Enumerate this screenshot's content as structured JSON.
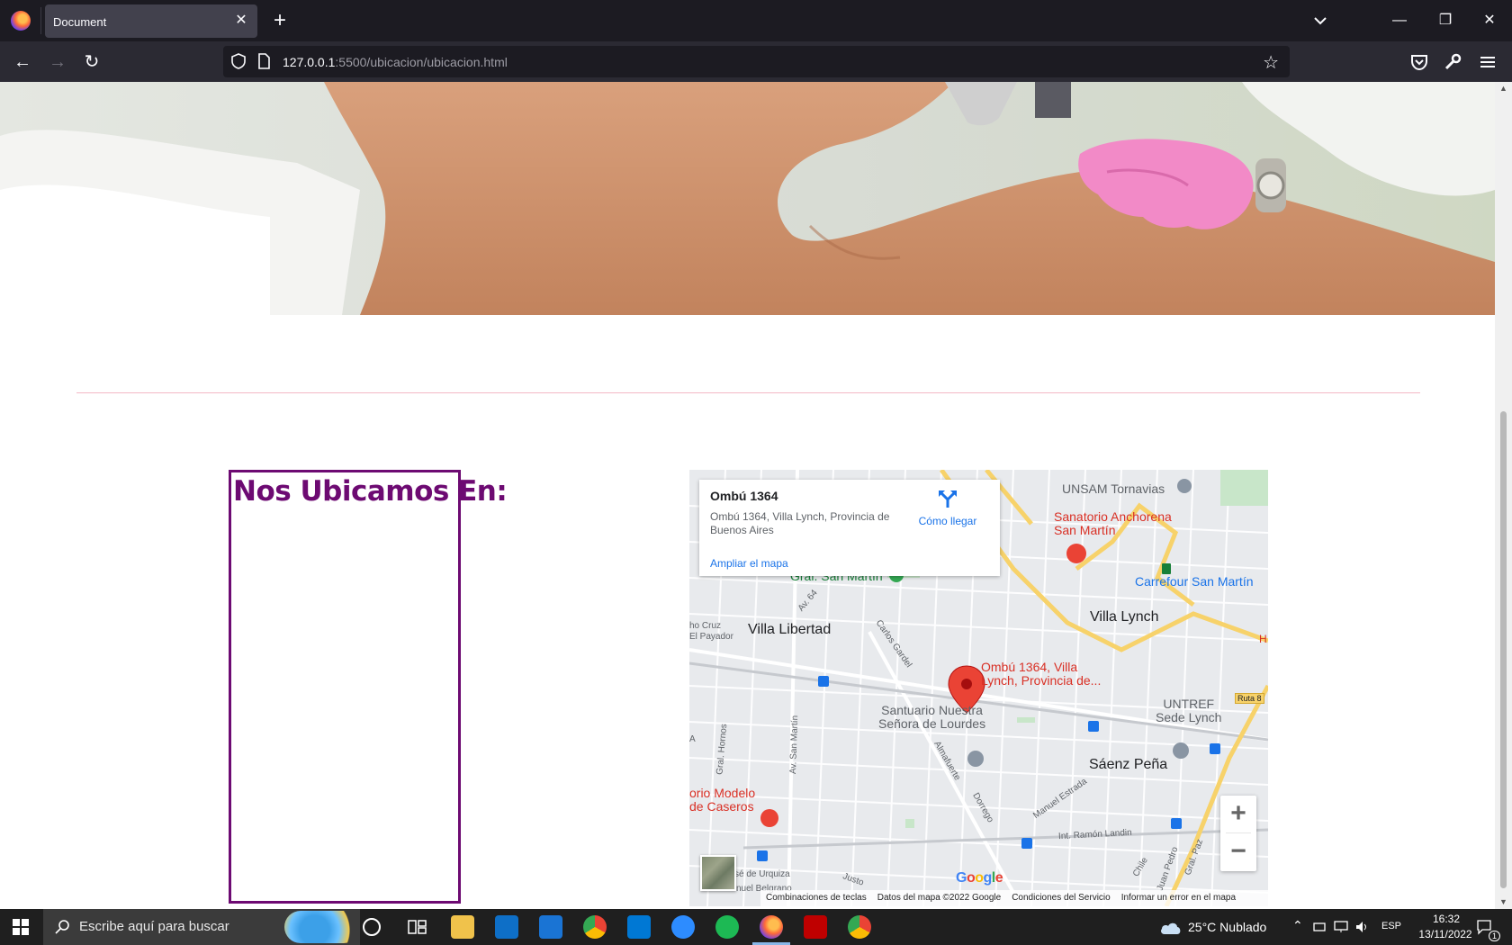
{
  "browser": {
    "tab_title": "Document",
    "url_host": "127.0.0.1",
    "url_path": ":5500/ubicacion/ubicacion.html"
  },
  "page": {
    "location_heading": "Nos Ubicamos En:"
  },
  "map": {
    "card_title": "Ombú 1364",
    "card_address": "Ombú 1364, Villa Lynch, Provincia de Buenos Aires",
    "directions_label": "Cómo llegar",
    "enlarge_link": "Ampliar el mapa",
    "pin_label_line1": "Ombú 1364, Villa",
    "pin_label_line2": "Lynch, Provincia de...",
    "labels": {
      "unsam": "UNSAM Tornavias",
      "sanatorio_line1": "Sanatorio Anchorena",
      "sanatorio_line2": "San Martín",
      "carrefour": "Carrefour San Martín",
      "gral_san_martin": "Gral. San Martín",
      "villa_libertad": "Villa Libertad",
      "villa_lynch": "Villa Lynch",
      "santuario_line1": "Santuario Nuestra",
      "santuario_line2": "Señora de Lourdes",
      "untref_line1": "UNTREF",
      "untref_line2": "Sede Lynch",
      "saenz_pena": "Sáenz Peña",
      "modelo_line1": "orio Modelo",
      "modelo_line2": "de Caseros",
      "ruta8": "Ruta 8",
      "av64": "Av. 64",
      "carlos_gardel": "Carlos Gardel",
      "cruz_line1": "ho Cruz",
      "cruz_line2": "El Payador",
      "av_san_martin": "Av. San Martín",
      "gral_hornos": "Gral. Hornos",
      "almafuerte": "Almafuerte",
      "dorrego": "Dorrego",
      "manuel_estrada": "Manuel Estrada",
      "ramon_landin": "Int. Ramón Landin",
      "chile": "Chile",
      "juan_pedro": "Juan Pedro",
      "gral_paz": "Gral. Paz",
      "urquiza": "sé de Urquiza",
      "belgrano": "nuel Belgrano",
      "justo": "Justo",
      "a_edge": "A",
      "h_edge": "H"
    },
    "zoom_in": "+",
    "zoom_out": "−",
    "google": "Google",
    "footer": {
      "shortcuts": "Combinaciones de teclas",
      "data": "Datos del mapa ©2022 Google",
      "terms": "Condiciones del Servicio",
      "report": "Informar un error en el mapa"
    }
  },
  "taskbar": {
    "search_placeholder": "Escribe aquí para buscar",
    "weather": "25°C  Nublado",
    "language": "ESP",
    "time": "16:32",
    "date": "13/11/2022",
    "notifications": "1"
  }
}
